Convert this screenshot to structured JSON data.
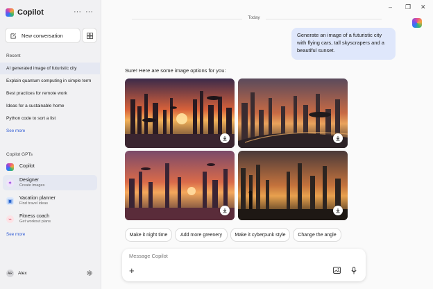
{
  "app": {
    "title": "Copilot",
    "more": "···"
  },
  "sidebar": {
    "new_conversation": "New conversation",
    "recent_label": "Recent",
    "recent": [
      "AI generated image of futuristic city",
      "Explain quantum computing in simple term",
      "Best practices for remote work",
      "Ideas for a sustainable home",
      "Python code to sort a list"
    ],
    "see_more": "See more",
    "gpts_label": "Copilot GPTs",
    "gpts": [
      {
        "name": "Copilot",
        "sub": ""
      },
      {
        "name": "Designer",
        "sub": "Create images"
      },
      {
        "name": "Vacation planner",
        "sub": "Find travel ideas"
      },
      {
        "name": "Fitness coach",
        "sub": "Get workout plans"
      }
    ],
    "see_more_gpts": "See more",
    "user": {
      "initials": "AR",
      "name": "Alex"
    }
  },
  "window_controls": {
    "minimize": "–",
    "restore": "❐",
    "close": "✕"
  },
  "chat": {
    "date_divider": "Today",
    "user_message": "Generate an image of a futuristic city with flying cars, tall skyscrapers and a beautiful sunset.",
    "reply": "Sure! Here are some image options for you:",
    "suggestions": [
      "Make it night time",
      "Add more greenery",
      "Make it cyberpunk style",
      "Change the angle"
    ]
  },
  "composer": {
    "placeholder": "Message Copilot"
  },
  "colors": {
    "accent": "#2f5bd4",
    "user_bubble": "#dfe7fb",
    "active_item": "#e5e8f2"
  }
}
